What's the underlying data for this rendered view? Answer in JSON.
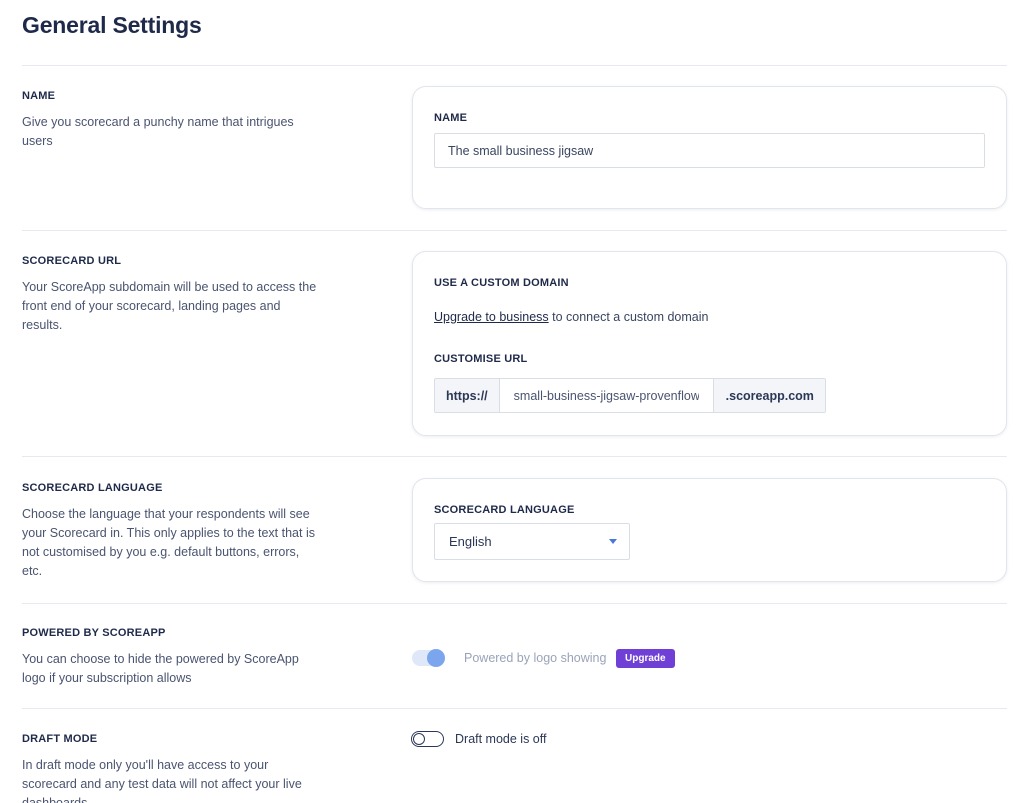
{
  "page": {
    "title": "General Settings"
  },
  "sections": {
    "name": {
      "title": "NAME",
      "description": "Give you scorecard a punchy name that intrigues users",
      "card": {
        "field_label": "NAME",
        "value": "The small business jigsaw"
      }
    },
    "url": {
      "title": "SCORECARD URL",
      "description": "Your ScoreApp subdomain will be used to access the front end of your scorecard, landing pages and results.",
      "card": {
        "custom_domain_label": "USE A CUSTOM DOMAIN",
        "upgrade_link": "Upgrade to business",
        "upgrade_text": " to connect a custom domain",
        "customise_label": "CUSTOMISE URL",
        "prefix": "https://",
        "subdomain": "small-business-jigsaw-provenflows",
        "suffix": ".scoreapp.com"
      }
    },
    "language": {
      "title": "SCORECARD LANGUAGE",
      "description": "Choose the language that your respondents will see your Scorecard in. This only applies to the text that is not customised by you e.g. default buttons, errors, etc.",
      "card": {
        "field_label": "SCORECARD LANGUAGE",
        "selected": "English"
      }
    },
    "powered": {
      "title": "POWERED BY SCOREAPP",
      "description": "You can choose to hide the powered by ScoreApp logo if your subscription allows",
      "toggle_label": "Powered by logo showing",
      "toggle_on": true,
      "badge": "Upgrade"
    },
    "draft": {
      "title": "DRAFT MODE",
      "description": "In draft mode only you'll have access to your scorecard and any test data will not affect your live dashboards",
      "toggle_label": "Draft mode is off",
      "toggle_on": false
    }
  },
  "colors": {
    "text_dark": "#1f2a4a",
    "accent_blue": "#7ba6ee",
    "badge_purple": "#6f3fd6"
  }
}
